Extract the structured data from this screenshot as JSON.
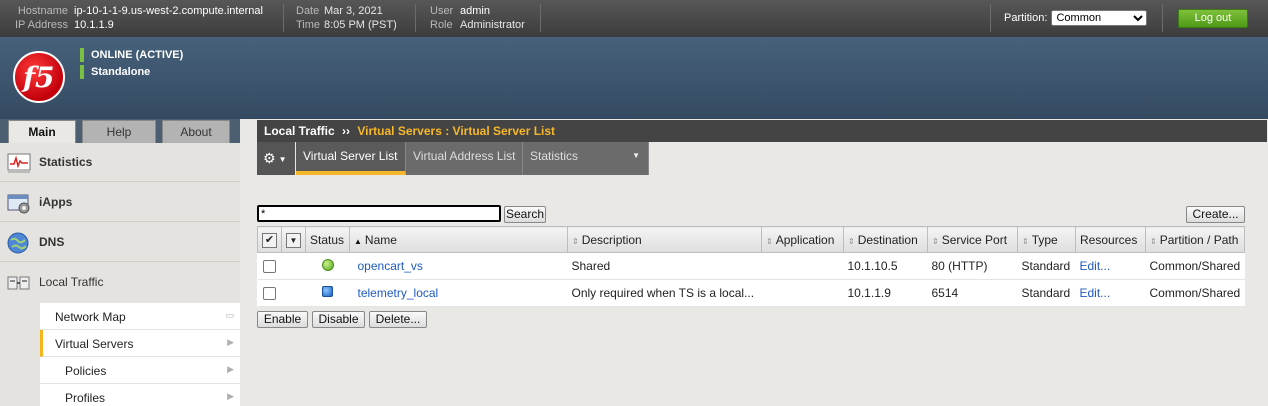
{
  "header": {
    "hostname_label": "Hostname",
    "hostname": "ip-10-1-1-9.us-west-2.compute.internal",
    "ip_label": "IP Address",
    "ip": "10.1.1.9",
    "date_label": "Date",
    "date": "Mar 3, 2021",
    "time_label": "Time",
    "time": "8:05 PM (PST)",
    "user_label": "User",
    "user": "admin",
    "role_label": "Role",
    "role": "Administrator",
    "partition_label": "Partition:",
    "partition_value": "Common",
    "logout_label": "Log out"
  },
  "banner": {
    "logo_text": "f5",
    "status_online": "ONLINE (ACTIVE)",
    "status_mode": "Standalone",
    "status_color": "#7ac142"
  },
  "nav": {
    "tabs": [
      "Main",
      "Help",
      "About"
    ],
    "sections": [
      {
        "label": "Statistics",
        "icon": "statistics-icon"
      },
      {
        "label": "iApps",
        "icon": "iapps-icon"
      },
      {
        "label": "DNS",
        "icon": "dns-globe-icon"
      },
      {
        "label": "Local Traffic",
        "icon": "local-traffic-icon"
      }
    ],
    "subitems": [
      "Network Map",
      "Virtual Servers",
      "Policies",
      "Profiles"
    ]
  },
  "breadcrumb": {
    "section": "Local Traffic",
    "separator": "››",
    "path": "Virtual Servers : Virtual Server List"
  },
  "tabs": [
    "Virtual Server List",
    "Virtual Address List",
    "Statistics"
  ],
  "search": {
    "value": "*",
    "button": "Search",
    "create_button": "Create..."
  },
  "table": {
    "columns": [
      "Status",
      "Name",
      "Description",
      "Application",
      "Destination",
      "Service Port",
      "Type",
      "Resources",
      "Partition / Path"
    ],
    "rows": [
      {
        "status": "green-circle",
        "name": "opencart_vs",
        "description": "Shared",
        "application": "",
        "destination": "10.1.10.5",
        "port": "80 (HTTP)",
        "type": "Standard",
        "resources": "Edit...",
        "partition": "Common/Shared"
      },
      {
        "status": "blue-square",
        "name": "telemetry_local",
        "description": "Only required when TS is a local...",
        "application": "",
        "destination": "10.1.1.9",
        "port": "6514",
        "type": "Standard",
        "resources": "Edit...",
        "partition": "Common/Shared"
      }
    ]
  },
  "actions": [
    "Enable",
    "Disable",
    "Delete..."
  ],
  "colors": {
    "accent": "#f6b72b",
    "link": "#1f5bbf",
    "logout_green": "#5aa61e",
    "banner": "#3d546c"
  }
}
